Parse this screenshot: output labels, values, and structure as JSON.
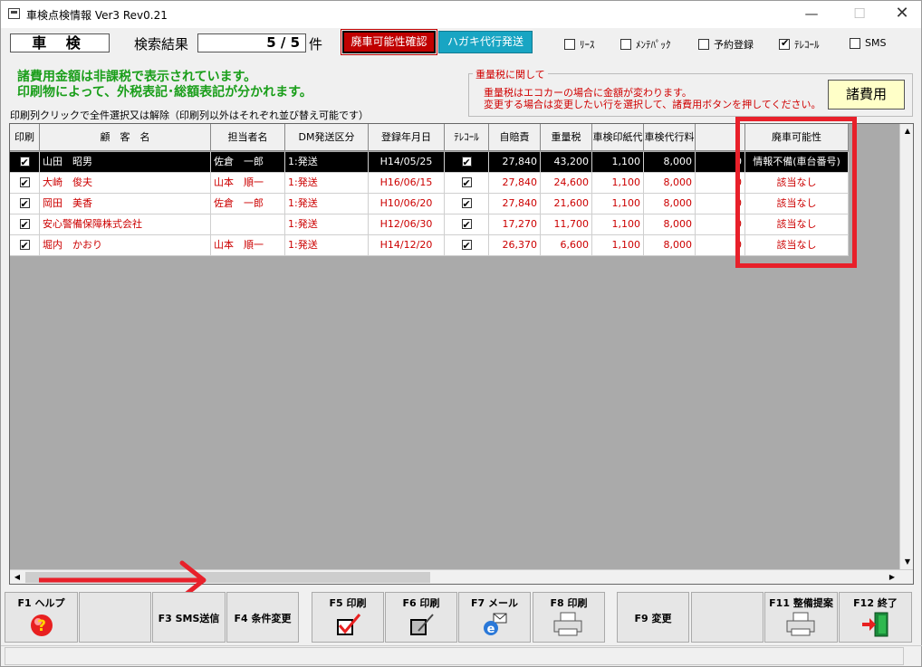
{
  "window": {
    "title": "車検点検情報 Ver3 Rev0.21",
    "min_glyph": "—",
    "max_glyph": "☐",
    "close_glyph": "✕"
  },
  "toolbar": {
    "category": "車 検",
    "search_label": "検索結果",
    "search_result": "5 / 5",
    "search_unit": "件",
    "btn_haisha": "廃車可能性確認",
    "btn_hagaki": "ハガキ代行発送",
    "filters": [
      {
        "label": "ﾘｰｽ",
        "checked": false
      },
      {
        "label": "ﾒﾝﾃﾊﾟｯｸ",
        "checked": false
      },
      {
        "label": "予約登録",
        "checked": false
      },
      {
        "label": "ﾃﾚｺｰﾙ",
        "checked": true
      },
      {
        "label": "SMS",
        "checked": false
      }
    ]
  },
  "notice": {
    "line1": "諸費用金額は非課税で表示されています。",
    "line2": "印刷物によって、外税表記･総額表記が分かれます。"
  },
  "grid_caption": "印刷列クリックで全件選択又は解除（印刷列以外はそれぞれ並び替え可能です）",
  "tax_box": {
    "title": "重量税に関して",
    "line1": "重量税はエコカーの場合に金額が変わります。",
    "line2": "変更する場合は変更したい行を選択して、諸費用ボタンを押してください。",
    "button": "諸費用"
  },
  "grid": {
    "headers": {
      "print": "印刷",
      "customer": "顧　客　名",
      "staff": "担当者名",
      "dm": "DM発送区分",
      "reg_date": "登録年月日",
      "telcall": "ﾃﾚｺｰﾙ",
      "jibaiseki": "自賠責",
      "jyuryozei": "重量税",
      "inshi": "車検印紙代",
      "daiko": "車検代行料",
      "blank": "",
      "haisha": "廃車可能性"
    },
    "rows": [
      {
        "customer": "山田　昭男",
        "staff": "佐倉　一郎",
        "dm": "1:発送",
        "reg_date": "H14/05/25",
        "jibaiseki": "27,840",
        "jyuryozei": "43,200",
        "inshi": "1,100",
        "daiko": "8,000",
        "extra": "0",
        "haisha": "情報不備(車台番号)",
        "selected": true
      },
      {
        "customer": "大崎　俊夫",
        "staff": "山本　順一",
        "dm": "1:発送",
        "reg_date": "H16/06/15",
        "jibaiseki": "27,840",
        "jyuryozei": "24,600",
        "inshi": "1,100",
        "daiko": "8,000",
        "extra": "0",
        "haisha": "該当なし",
        "selected": false
      },
      {
        "customer": "岡田　美香",
        "staff": "佐倉　一郎",
        "dm": "1:発送",
        "reg_date": "H10/06/20",
        "jibaiseki": "27,840",
        "jyuryozei": "21,600",
        "inshi": "1,100",
        "daiko": "8,000",
        "extra": "0",
        "haisha": "該当なし",
        "selected": false
      },
      {
        "customer": "安心警備保障株式会社",
        "staff": "",
        "dm": "1:発送",
        "reg_date": "H12/06/30",
        "jibaiseki": "17,270",
        "jyuryozei": "11,700",
        "inshi": "1,100",
        "daiko": "8,000",
        "extra": "0",
        "haisha": "該当なし",
        "selected": false
      },
      {
        "customer": "堀内　かおり",
        "staff": "山本　順一",
        "dm": "1:発送",
        "reg_date": "H14/12/20",
        "jibaiseki": "26,370",
        "jyuryozei": "6,600",
        "inshi": "1,100",
        "daiko": "8,000",
        "extra": "0",
        "haisha": "該当なし",
        "selected": false
      }
    ]
  },
  "fkeys": {
    "f1": "F1 ヘルプ",
    "f3": "F3 SMS送信",
    "f4": "F4 条件変更",
    "f5": "F5 印刷",
    "f6": "F6 印刷",
    "f7": "F7 メール",
    "f8": "F8 印刷",
    "f9": "F9 変更",
    "f11": "F11 整備提案",
    "f12": "F12 終了"
  },
  "colors": {
    "highlight": "#e8202a",
    "notice": "#1a9e1a",
    "alert_text": "#cc0000"
  }
}
